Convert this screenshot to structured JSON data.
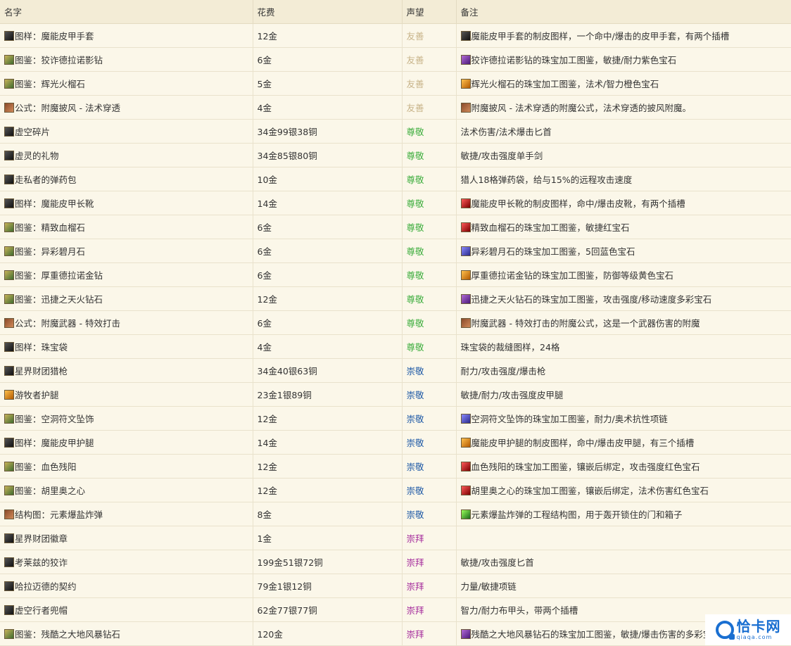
{
  "headers": {
    "name": "名字",
    "cost": "花费",
    "rep": "声望",
    "note": "备注"
  },
  "rows": [
    {
      "name": "图样：魔能皮甲手套",
      "cost": "12金",
      "rep": "友善",
      "note": "魔能皮甲手套的制皮图样，一个命中/爆击的皮甲手套，有两个插槽"
    },
    {
      "name": "图鉴：狡诈德拉诺影钻",
      "cost": "6金",
      "rep": "友善",
      "note": "狡诈德拉诺影钻的珠宝加工图鉴，敏捷/耐力紫色宝石"
    },
    {
      "name": "图鉴：辉光火榴石",
      "cost": "5金",
      "rep": "友善",
      "note": "辉光火榴石的珠宝加工图鉴，法术/智力橙色宝石"
    },
    {
      "name": "公式：附魔披风 - 法术穿透",
      "cost": "4金",
      "rep": "友善",
      "note": "附魔披风 - 法术穿透的附魔公式，法术穿透的披风附魔。"
    },
    {
      "name": "虚空碎片",
      "cost": "34金99银38铜",
      "rep": "尊敬",
      "note": "法术伤害/法术爆击匕首"
    },
    {
      "name": "虚灵的礼物",
      "cost": "34金85银80铜",
      "rep": "尊敬",
      "note": "敏捷/攻击强度单手剑"
    },
    {
      "name": "走私者的弹药包",
      "cost": "10金",
      "rep": "尊敬",
      "note": "猎人18格弹药袋，给与15%的远程攻击速度"
    },
    {
      "name": "图样：魔能皮甲长靴",
      "cost": "14金",
      "rep": "尊敬",
      "note": "魔能皮甲长靴的制皮图样，命中/爆击皮靴，有两个插槽"
    },
    {
      "name": "图鉴：精致血榴石",
      "cost": "6金",
      "rep": "尊敬",
      "note": "精致血榴石的珠宝加工图鉴，敏捷红宝石"
    },
    {
      "name": "图鉴：异彩碧月石",
      "cost": "6金",
      "rep": "尊敬",
      "note": "异彩碧月石的珠宝加工图鉴，5回蓝色宝石"
    },
    {
      "name": "图鉴：厚重德拉诺金钻",
      "cost": "6金",
      "rep": "尊敬",
      "note": "厚重德拉诺金钻的珠宝加工图鉴，防御等级黄色宝石"
    },
    {
      "name": "图鉴：迅捷之天火钻石",
      "cost": "12金",
      "rep": "尊敬",
      "note": "迅捷之天火钻石的珠宝加工图鉴，攻击强度/移动速度多彩宝石"
    },
    {
      "name": "公式：附魔武器 - 特效打击",
      "cost": "6金",
      "rep": "尊敬",
      "note": "附魔武器 - 特效打击的附魔公式，这是一个武器伤害的附魔"
    },
    {
      "name": "图样：珠宝袋",
      "cost": "4金",
      "rep": "尊敬",
      "note": "珠宝袋的裁缝图样，24格"
    },
    {
      "name": "星界财团猎枪",
      "cost": "34金40银63铜",
      "rep": "崇敬",
      "note": "耐力/攻击强度/爆击枪"
    },
    {
      "name": "游牧者护腿",
      "cost": "23金1银89铜",
      "rep": "崇敬",
      "note": "敏捷/耐力/攻击强度皮甲腿"
    },
    {
      "name": "图鉴：空洞符文坠饰",
      "cost": "12金",
      "rep": "崇敬",
      "note": "空洞符文坠饰的珠宝加工图鉴，耐力/奥术抗性项链"
    },
    {
      "name": "图样：魔能皮甲护腿",
      "cost": "14金",
      "rep": "崇敬",
      "note": "魔能皮甲护腿的制皮图样，命中/爆击皮甲腿，有三个插槽"
    },
    {
      "name": "图鉴：血色残阳",
      "cost": "12金",
      "rep": "崇敬",
      "note": "血色残阳的珠宝加工图鉴，镶嵌后绑定，攻击强度红色宝石"
    },
    {
      "name": "图鉴：胡里奥之心",
      "cost": "12金",
      "rep": "崇敬",
      "note": "胡里奥之心的珠宝加工图鉴，镶嵌后绑定，法术伤害红色宝石"
    },
    {
      "name": "结构图：元素爆盐炸弹",
      "cost": "8金",
      "rep": "崇敬",
      "note": "元素爆盐炸弹的工程结构图，用于轰开锁住的门和箱子"
    },
    {
      "name": "星界财团徽章",
      "cost": "1金",
      "rep": "崇拜",
      "note": ""
    },
    {
      "name": "考莱兹的狡诈",
      "cost": "199金51银72铜",
      "rep": "崇拜",
      "note": "敏捷/攻击强度匕首"
    },
    {
      "name": "哈拉迈德的契约",
      "cost": "79金1银12铜",
      "rep": "崇拜",
      "note": "力量/敏捷项链"
    },
    {
      "name": "虚空行者兜帽",
      "cost": "62金77银77铜",
      "rep": "崇拜",
      "note": "智力/耐力布甲头，带两个插槽"
    },
    {
      "name": "图鉴：残酷之大地风暴钻石",
      "cost": "120金",
      "rep": "崇拜",
      "note": "残酷之大地风暴钻石的珠宝加工图鉴，敏捷/爆击伤害的多彩宝石"
    }
  ],
  "icons": {
    "name": [
      "pattern-icon",
      "design-icon",
      "design-icon",
      "formula-icon",
      "dagger-icon",
      "sword-icon",
      "ammo-pouch-icon",
      "pattern-icon",
      "design-icon",
      "design-icon",
      "design-icon",
      "design-icon",
      "formula-icon",
      "pattern-icon",
      "gun-icon",
      "leggings-icon",
      "design-icon",
      "pattern-icon",
      "design-icon",
      "design-icon",
      "schematic-icon",
      "tabard-icon",
      "dagger-icon",
      "necklace-icon",
      "hood-icon",
      "design-icon"
    ],
    "note": [
      "gloves-icon",
      "purple-gem-icon",
      "orange-gem-icon",
      "cloak-icon",
      null,
      null,
      null,
      "boots-icon",
      "red-gem-icon",
      "blue-gem-icon",
      "yellow-gem-icon",
      "meta-gem-icon",
      "weapon-enchant-icon",
      null,
      null,
      null,
      "pendant-icon",
      "leggings-icon",
      "red-gem-icon",
      "red-gem-icon",
      "bomb-icon",
      null,
      null,
      null,
      null,
      "meta-gem-icon"
    ]
  },
  "watermark": {
    "title": "恰卡网",
    "subtitle": "qiaqa.com"
  }
}
